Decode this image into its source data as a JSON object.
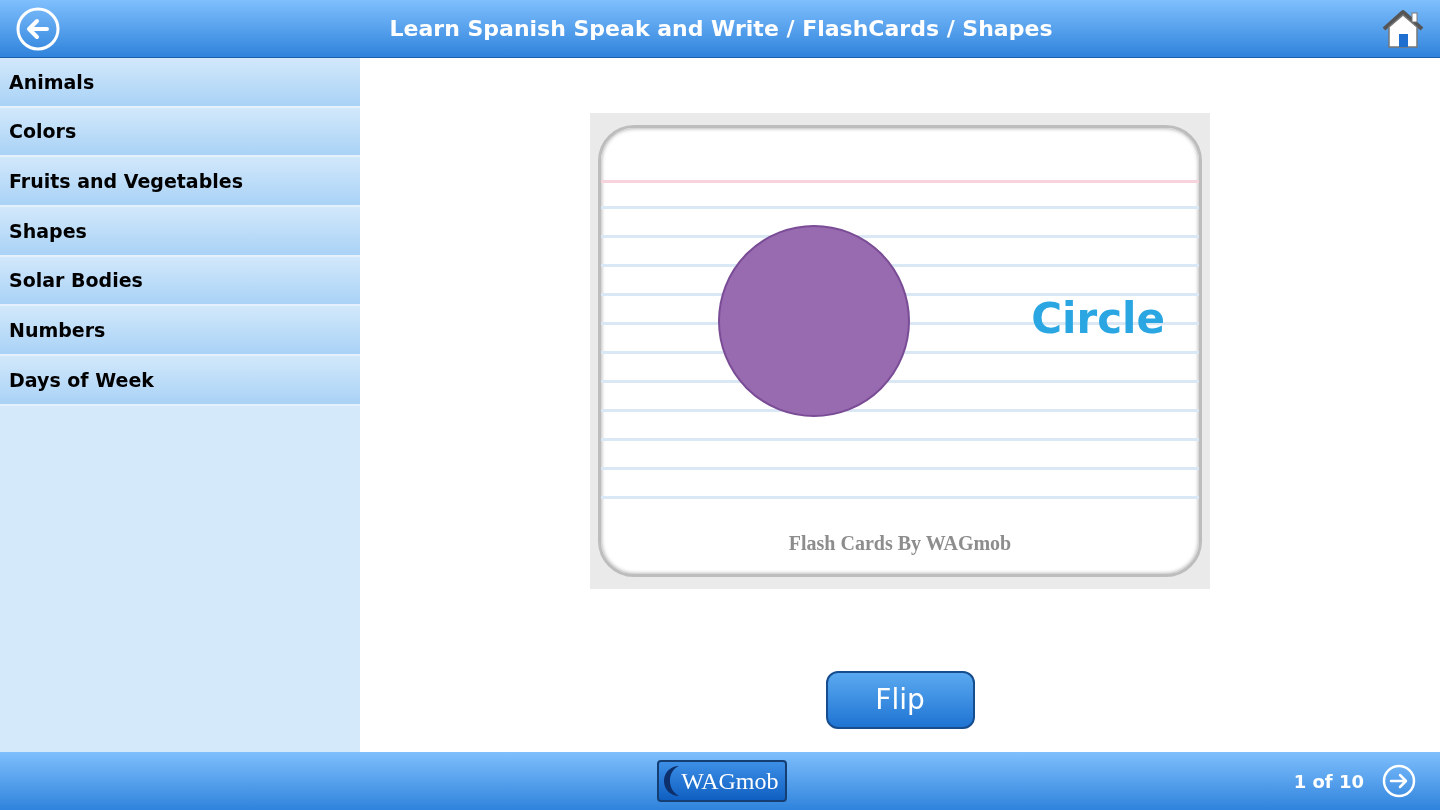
{
  "header": {
    "title": "Learn Spanish Speak and Write / FlashCards / Shapes"
  },
  "sidebar": {
    "items": [
      {
        "label": "Animals"
      },
      {
        "label": "Colors"
      },
      {
        "label": "Fruits and Vegetables"
      },
      {
        "label": "Shapes"
      },
      {
        "label": "Solar Bodies"
      },
      {
        "label": "Numbers"
      },
      {
        "label": "Days of Week"
      }
    ]
  },
  "flashcard": {
    "word": "Circle",
    "footer": "Flash Cards By WAGmob"
  },
  "flip_button": "Flip",
  "footer": {
    "logo": "WAGmob",
    "page": "1 of 10"
  }
}
